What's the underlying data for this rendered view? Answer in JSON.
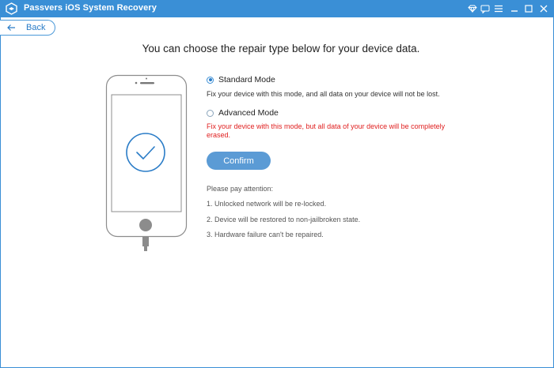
{
  "titlebar": {
    "title": "Passvers iOS System Recovery",
    "icons": [
      "app-logo-icon",
      "diamond-icon",
      "chat-icon",
      "menu-icon",
      "minimize-icon",
      "maximize-icon",
      "close-icon"
    ]
  },
  "nav": {
    "back_label": "Back"
  },
  "main": {
    "heading": "You can choose the repair type below for your device data.",
    "options": [
      {
        "label": "Standard Mode",
        "selected": true,
        "description": "Fix your device with this mode, and all data on your device will not be lost."
      },
      {
        "label": "Advanced Mode",
        "selected": false,
        "description": "Fix your device with this mode, but all data of your device will be completely erased."
      }
    ],
    "confirm_label": "Confirm",
    "attention_title": "Please pay attention:",
    "notes": [
      "1. Unlocked network will be re-locked.",
      "2. Device will be restored to non-jailbroken state.",
      "3. Hardware failure can't be repaired."
    ]
  },
  "colors": {
    "accent": "#3a8fd6",
    "button": "#5b9bd5",
    "warning": "#e02020"
  }
}
